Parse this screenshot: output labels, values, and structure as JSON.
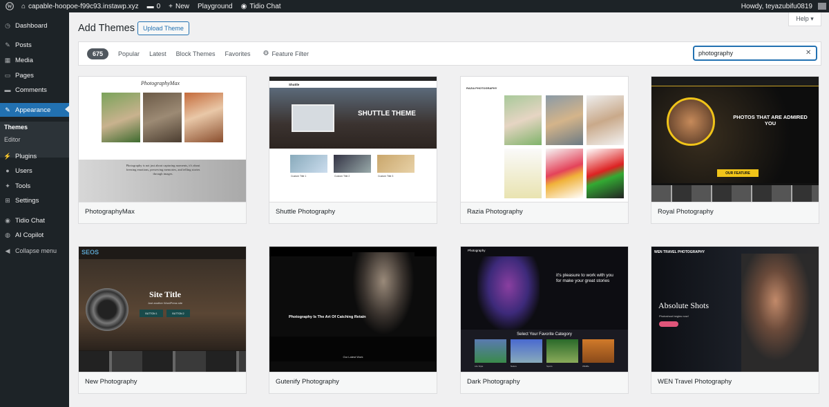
{
  "adminbar": {
    "site": "capable-hoopoe-f99c93.instawp.xyz",
    "comments": "0",
    "new": "New",
    "playground": "Playground",
    "tidio": "Tidio Chat",
    "howdy": "Howdy, teyazubifu0819"
  },
  "menu": [
    {
      "label": "Dashboard",
      "icon": "◷"
    },
    {
      "label": "Posts",
      "icon": "✎"
    },
    {
      "label": "Media",
      "icon": "▦"
    },
    {
      "label": "Pages",
      "icon": "▭"
    },
    {
      "label": "Comments",
      "icon": "▬"
    },
    {
      "label": "Appearance",
      "icon": "✎"
    },
    {
      "label": "Plugins",
      "icon": "⚡"
    },
    {
      "label": "Users",
      "icon": "●"
    },
    {
      "label": "Tools",
      "icon": "✦"
    },
    {
      "label": "Settings",
      "icon": "⊞"
    },
    {
      "label": "Tidio Chat",
      "icon": "◉"
    },
    {
      "label": "AI Copilot",
      "icon": "◍"
    },
    {
      "label": "Collapse menu",
      "icon": "◀"
    }
  ],
  "submenu": [
    "Themes",
    "Editor"
  ],
  "page": {
    "title": "Add Themes",
    "upload": "Upload Theme",
    "help": "Help ▾"
  },
  "filter": {
    "count": "675",
    "tabs": [
      "Popular",
      "Latest",
      "Block Themes",
      "Favorites"
    ],
    "feature": "Feature Filter",
    "search_value": "photography"
  },
  "themes": [
    {
      "name": "PhotographyMax",
      "shot": {
        "logo": "PhotographyMax",
        "quote": "Photography is not just about capturing moments, it's about freezing emotions, preserving memories, and telling stories through images."
      }
    },
    {
      "name": "Shuttle Photography",
      "shot": {
        "logo": "Shuttle",
        "hero": "SHUTTLE THEME",
        "cards": [
          "Custom Title 1",
          "Custom Title 2",
          "Custom Title 3"
        ]
      }
    },
    {
      "name": "Razia Photography",
      "shot": {
        "logo": "RAZIA PHOTOGRAPHY"
      }
    },
    {
      "name": "Royal Photography",
      "shot": {
        "hero": "PHOTOS THAT ARE ADMIRED YOU",
        "feature": "OUR FEATURE"
      }
    },
    {
      "name": "New Photography",
      "shot": {
        "logo": "SEOS",
        "hero": "Site Title",
        "sub": "Just another WordPress site",
        "b1": "BUTTON 1",
        "b2": "BUTTON 2"
      }
    },
    {
      "name": "Gutenify Photography",
      "shot": {
        "hero": "Photography Is The Art Of Catching Retain",
        "work": "Our Latest Work"
      }
    },
    {
      "name": "Dark Photography",
      "shot": {
        "logo": "Photography",
        "hero": "it's pleasure to work with you for make your great stories",
        "gallery": "Select Your Favorite Category",
        "cats": [
          "Life Style",
          "Nature",
          "Sports",
          "Wildlife"
        ]
      }
    },
    {
      "name": "WEN Travel Photography",
      "shot": {
        "logo": "WEN TRAVEL PHOTOGRAPHY",
        "hero": "Absolute Shots",
        "sub": "Photoshoot begins now!"
      }
    }
  ]
}
